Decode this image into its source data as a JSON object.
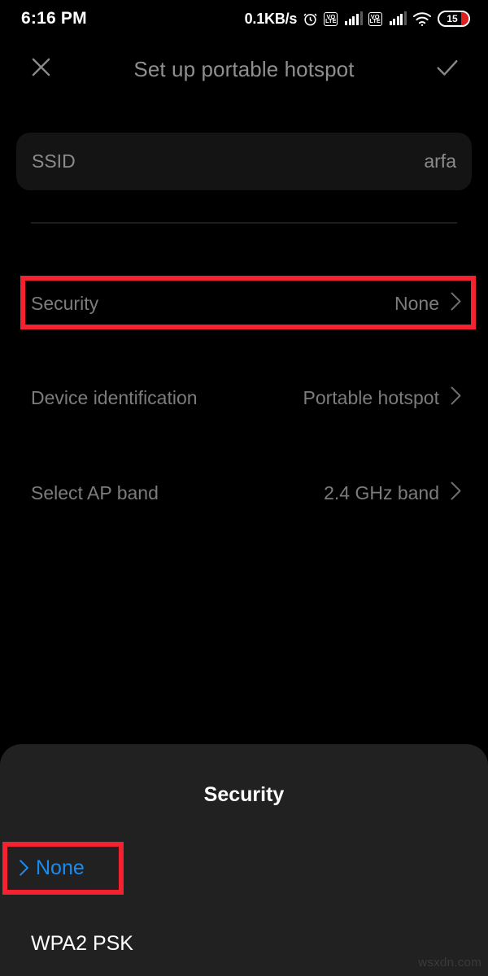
{
  "statusbar": {
    "clock": "6:16 PM",
    "net_speed": "0.1KB/s",
    "alarm_icon": "alarm-clock-icon",
    "sim1_label": "VO LTE",
    "sim1_top": "VO",
    "sim1_bottom": "LTE",
    "sim2_top": "VO",
    "sim2_bottom": "LTE",
    "wifi_icon": "wifi-icon",
    "battery_level": "15"
  },
  "header": {
    "title": "Set up portable hotspot",
    "close_icon": "close-icon",
    "confirm_icon": "checkmark-icon"
  },
  "settings": {
    "ssid": {
      "label": "SSID",
      "value": "arfa"
    },
    "rows": [
      {
        "label": "Security",
        "value": "None",
        "chevron": "chevron-right-icon"
      },
      {
        "label": "Device identification",
        "value": "Portable hotspot",
        "chevron": "chevron-right-icon"
      },
      {
        "label": "Select AP band",
        "value": "2.4 GHz band",
        "chevron": "chevron-right-icon"
      }
    ]
  },
  "sheet": {
    "title": "Security",
    "items": [
      {
        "label": "None",
        "selected": true,
        "marker": "chevron-right-icon"
      },
      {
        "label": "WPA2 PSK",
        "selected": false,
        "marker": ""
      }
    ]
  },
  "annotations": {
    "highlight_color": "#f42230",
    "security_row_highlight": "Security",
    "none_option_highlight": "None"
  },
  "watermark": "wsxdn.com",
  "colors": {
    "background": "#000000",
    "sheet_background": "#212121",
    "field_background": "#141414",
    "muted_text": "#7c7c7c",
    "title_text": "#8f8f8f",
    "accent_blue": "#1a8cf0",
    "annotation_red": "#f42230"
  }
}
